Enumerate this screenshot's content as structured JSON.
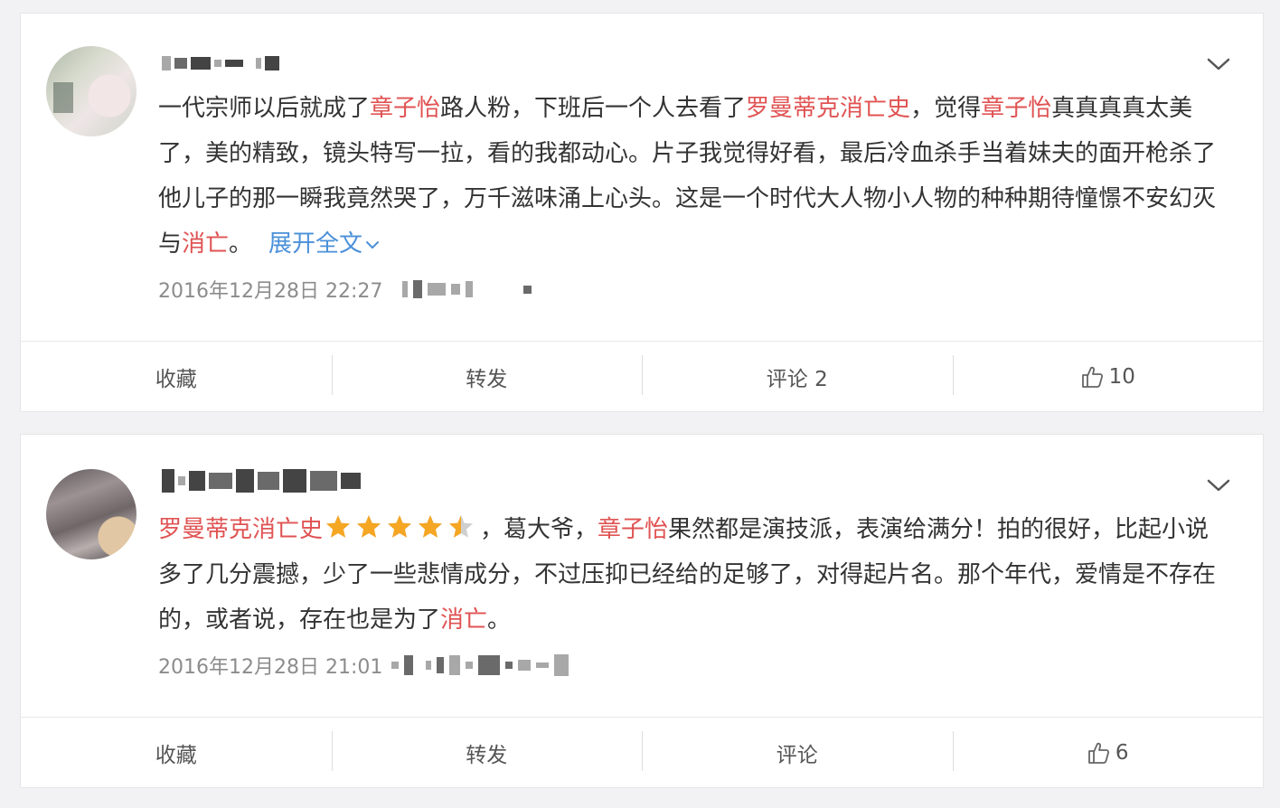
{
  "feed": {
    "posts": [
      {
        "text_parts": [
          {
            "text": "一代宗师以后就成了",
            "kw": false
          },
          {
            "text": "章子怡",
            "kw": true
          },
          {
            "text": "路人粉，下班后一个人去看了",
            "kw": false
          },
          {
            "text": "罗曼蒂克消亡史",
            "kw": true
          },
          {
            "text": "，觉得",
            "kw": false
          },
          {
            "text": "章子怡",
            "kw": true
          },
          {
            "text": "真真真真太美了，美的精致，镜头特写一拉，看的我都动心。片子我觉得好看，最后冷血杀手当着妹夫的面开枪杀了他儿子的那一瞬我竟然哭了，万千滋味涌上心头。这是一个时代大人物小人物的种种期待憧憬不安幻灭与",
            "kw": false
          },
          {
            "text": "消亡",
            "kw": true
          },
          {
            "text": "。",
            "kw": false
          }
        ],
        "expand_label": "展开全文",
        "timestamp": "2016年12月28日 22:27",
        "actions": {
          "favorite": "收藏",
          "repost": "转发",
          "comment": "评论 2",
          "likes": "10"
        }
      },
      {
        "title_link": "罗曼蒂克消亡史",
        "rating": 4.5,
        "text_parts": [
          {
            "text": "，葛大爷，",
            "kw": false
          },
          {
            "text": "章子怡",
            "kw": true
          },
          {
            "text": "果然都是演技派，表演给满分！拍的很好，比起小说多了几分震撼，少了一些悲情成分，不过压抑已经给的足够了，对得起片名。那个年代，爱情是不存在的，或者说，存在也是为了",
            "kw": false
          },
          {
            "text": "消亡",
            "kw": true
          },
          {
            "text": "。",
            "kw": false
          }
        ],
        "timestamp": "2016年12月28日 21:01",
        "actions": {
          "favorite": "收藏",
          "repost": "转发",
          "comment": "评论",
          "likes": "6"
        }
      }
    ]
  },
  "colors": {
    "keyword": "#e05353",
    "link": "#4a90d9",
    "star": "#f5a623",
    "text": "#333333",
    "meta": "#8c8c8c"
  },
  "icons": [
    "chevron-down-icon",
    "thumbs-up-icon",
    "star-icon",
    "chevron-down-small-icon"
  ]
}
